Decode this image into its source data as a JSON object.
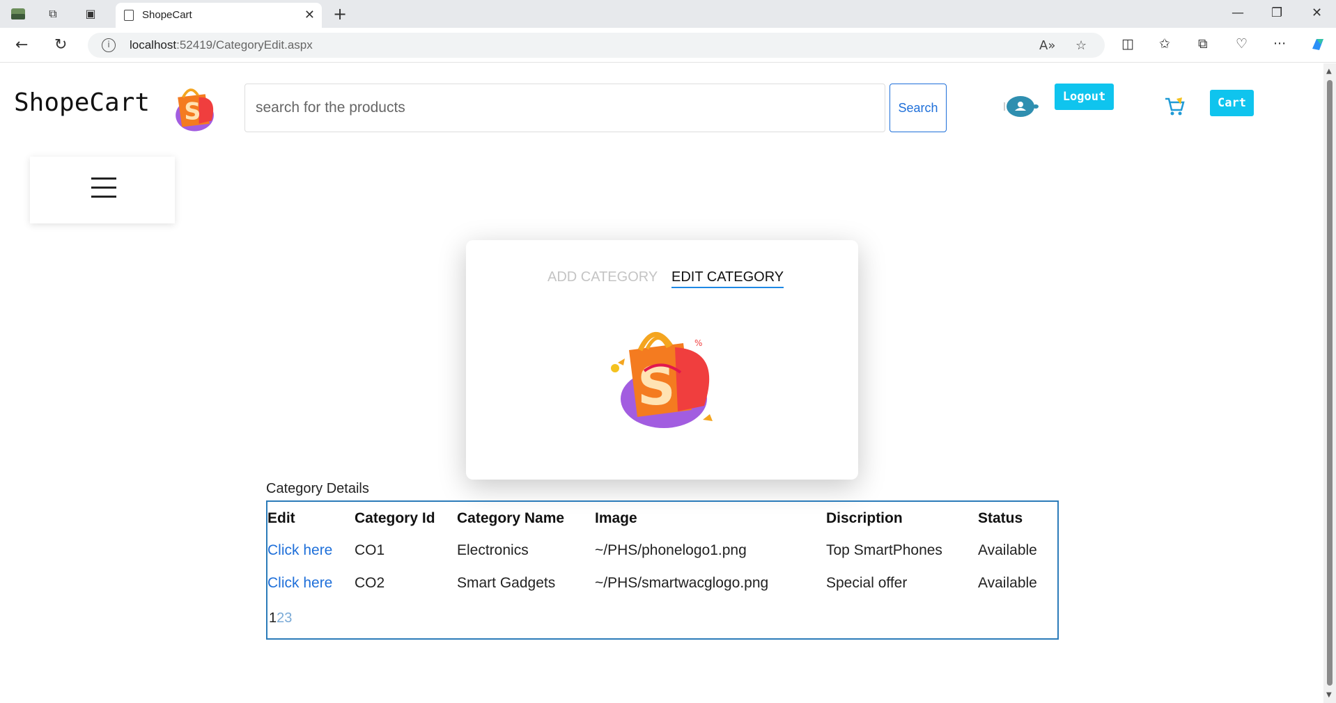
{
  "browser": {
    "tab_title": "ShopeCart",
    "url_host": "localhost",
    "url_rest": ":52419/CategoryEdit.aspx"
  },
  "header": {
    "brand": "ShopeCart",
    "search_placeholder": "search for the products",
    "search_button": "Search",
    "logout_button": "Logout",
    "cart_button": "Cart"
  },
  "card": {
    "tab_add": "ADD CATEGORY",
    "tab_edit": "EDIT CATEGORY"
  },
  "table": {
    "caption": "Category Details",
    "headers": [
      "Edit",
      "Category Id",
      "Category Name",
      "Image",
      "Discription",
      "Status"
    ],
    "rows": [
      {
        "edit": "Click here",
        "id": "CO1",
        "name": "Electronics",
        "image": "~/PHS/phonelogo1.png",
        "desc": "Top SmartPhones",
        "status": "Available"
      },
      {
        "edit": "Click here",
        "id": "CO2",
        "name": "Smart Gadgets",
        "image": "~/PHS/smartwacglogo.png",
        "desc": "Special offer",
        "status": "Available"
      }
    ],
    "pager": [
      "1",
      "2",
      "3"
    ]
  },
  "colors": {
    "accent_button": "#0fc4ee",
    "link": "#1e6fd9",
    "grid_border": "#2b7bb9"
  }
}
